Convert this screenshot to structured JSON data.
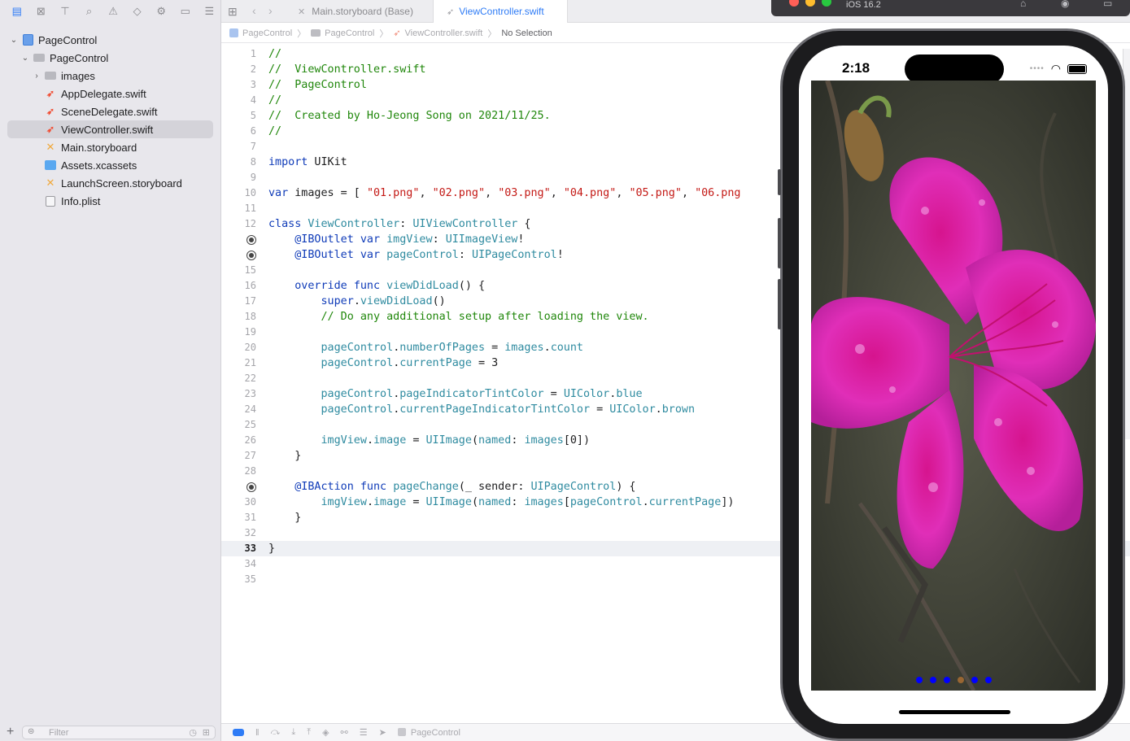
{
  "navigator": {
    "toolbar_icons": [
      "folder-icon",
      "source-control-icon",
      "symbol-icon",
      "find-icon",
      "issue-icon",
      "test-icon",
      "debug-icon",
      "breakpoint-icon",
      "report-icon"
    ],
    "tree": [
      {
        "label": "PageControl",
        "kind": "project",
        "level": 0,
        "expanded": true
      },
      {
        "label": "PageControl",
        "kind": "folder",
        "level": 1,
        "expanded": true
      },
      {
        "label": "images",
        "kind": "folder",
        "level": 2,
        "expanded": false
      },
      {
        "label": "AppDelegate.swift",
        "kind": "swift",
        "level": 2
      },
      {
        "label": "SceneDelegate.swift",
        "kind": "swift",
        "level": 2
      },
      {
        "label": "ViewController.swift",
        "kind": "swift",
        "level": 2,
        "selected": true
      },
      {
        "label": "Main.storyboard",
        "kind": "storyboard",
        "level": 2
      },
      {
        "label": "Assets.xcassets",
        "kind": "assets",
        "level": 2
      },
      {
        "label": "LaunchScreen.storyboard",
        "kind": "storyboard",
        "level": 2
      },
      {
        "label": "Info.plist",
        "kind": "plist",
        "level": 2
      }
    ],
    "filter_placeholder": "Filter"
  },
  "editor": {
    "tabs": [
      {
        "label": "Main.storyboard (Base)",
        "active": false
      },
      {
        "label": "ViewController.swift",
        "active": true
      }
    ],
    "jumpbar": [
      "PageControl",
      "PageControl",
      "ViewController.swift",
      "No Selection"
    ],
    "current_line": 33,
    "lines": [
      {
        "n": "1",
        "tokens": [
          [
            "cm",
            "//"
          ]
        ]
      },
      {
        "n": "2",
        "tokens": [
          [
            "cm",
            "//  ViewController.swift"
          ]
        ]
      },
      {
        "n": "3",
        "tokens": [
          [
            "cm",
            "//  PageControl"
          ]
        ]
      },
      {
        "n": "4",
        "tokens": [
          [
            "cm",
            "//"
          ]
        ]
      },
      {
        "n": "5",
        "tokens": [
          [
            "cm",
            "//  Created by Ho-Jeong Song on 2021/11/25."
          ]
        ]
      },
      {
        "n": "6",
        "tokens": [
          [
            "cm",
            "//"
          ]
        ]
      },
      {
        "n": "7",
        "tokens": []
      },
      {
        "n": "8",
        "tokens": [
          [
            "kw",
            "import"
          ],
          [
            "",
            " UIKit"
          ]
        ]
      },
      {
        "n": "9",
        "tokens": []
      },
      {
        "n": "10",
        "tokens": [
          [
            "kw",
            "var"
          ],
          [
            "",
            " images = [ "
          ],
          [
            "st",
            "\"01.png\""
          ],
          [
            "",
            ", "
          ],
          [
            "st",
            "\"02.png\""
          ],
          [
            "",
            ", "
          ],
          [
            "st",
            "\"03.png\""
          ],
          [
            "",
            ", "
          ],
          [
            "st",
            "\"04.png\""
          ],
          [
            "",
            ", "
          ],
          [
            "st",
            "\"05.png\""
          ],
          [
            "",
            ", "
          ],
          [
            "st",
            "\"06.png"
          ]
        ]
      },
      {
        "n": "11",
        "tokens": []
      },
      {
        "n": "12",
        "tokens": [
          [
            "kw",
            "class"
          ],
          [
            "",
            " "
          ],
          [
            "ty",
            "ViewController"
          ],
          [
            "",
            ": "
          ],
          [
            "ty",
            "UIViewController"
          ],
          [
            "",
            " {"
          ]
        ]
      },
      {
        "n": "",
        "outlet": true,
        "tokens": [
          [
            "",
            "    "
          ],
          [
            "kw",
            "@IBOutlet"
          ],
          [
            "",
            " "
          ],
          [
            "kw",
            "var"
          ],
          [
            "",
            " "
          ],
          [
            "ty",
            "imgView"
          ],
          [
            "",
            ": "
          ],
          [
            "ty",
            "UIImageView"
          ],
          [
            "",
            "!"
          ]
        ]
      },
      {
        "n": "",
        "outlet": true,
        "tokens": [
          [
            "",
            "    "
          ],
          [
            "kw",
            "@IBOutlet"
          ],
          [
            "",
            " "
          ],
          [
            "kw",
            "var"
          ],
          [
            "",
            " "
          ],
          [
            "ty",
            "pageControl"
          ],
          [
            "",
            ": "
          ],
          [
            "ty",
            "UIPageControl"
          ],
          [
            "",
            "!"
          ]
        ]
      },
      {
        "n": "15",
        "tokens": []
      },
      {
        "n": "16",
        "tokens": [
          [
            "",
            "    "
          ],
          [
            "kw",
            "override"
          ],
          [
            "",
            " "
          ],
          [
            "kw",
            "func"
          ],
          [
            "",
            " "
          ],
          [
            "ty",
            "viewDidLoad"
          ],
          [
            "",
            "() {"
          ]
        ]
      },
      {
        "n": "17",
        "tokens": [
          [
            "",
            "        "
          ],
          [
            "kw",
            "super"
          ],
          [
            "",
            "."
          ],
          [
            "pm",
            "viewDidLoad"
          ],
          [
            "",
            "()"
          ]
        ]
      },
      {
        "n": "18",
        "tokens": [
          [
            "",
            "        "
          ],
          [
            "cm",
            "// Do any additional setup after loading the view."
          ]
        ]
      },
      {
        "n": "19",
        "tokens": []
      },
      {
        "n": "20",
        "tokens": [
          [
            "",
            "        "
          ],
          [
            "pm",
            "pageControl"
          ],
          [
            "",
            "."
          ],
          [
            "pm",
            "numberOfPages"
          ],
          [
            "",
            " = "
          ],
          [
            "pm",
            "images"
          ],
          [
            "",
            "."
          ],
          [
            "pm",
            "count"
          ]
        ]
      },
      {
        "n": "21",
        "tokens": [
          [
            "",
            "        "
          ],
          [
            "pm",
            "pageControl"
          ],
          [
            "",
            "."
          ],
          [
            "pm",
            "currentPage"
          ],
          [
            "",
            " = 3"
          ]
        ]
      },
      {
        "n": "22",
        "tokens": []
      },
      {
        "n": "23",
        "tokens": [
          [
            "",
            "        "
          ],
          [
            "pm",
            "pageControl"
          ],
          [
            "",
            "."
          ],
          [
            "pm",
            "pageIndicatorTintColor"
          ],
          [
            "",
            " = "
          ],
          [
            "ty",
            "UIColor"
          ],
          [
            "",
            "."
          ],
          [
            "pm",
            "blue"
          ]
        ]
      },
      {
        "n": "24",
        "tokens": [
          [
            "",
            "        "
          ],
          [
            "pm",
            "pageControl"
          ],
          [
            "",
            "."
          ],
          [
            "pm",
            "currentPageIndicatorTintColor"
          ],
          [
            "",
            " = "
          ],
          [
            "ty",
            "UIColor"
          ],
          [
            "",
            "."
          ],
          [
            "pm",
            "brown"
          ]
        ]
      },
      {
        "n": "25",
        "tokens": []
      },
      {
        "n": "26",
        "tokens": [
          [
            "",
            "        "
          ],
          [
            "pm",
            "imgView"
          ],
          [
            "",
            "."
          ],
          [
            "pm",
            "image"
          ],
          [
            "",
            " = "
          ],
          [
            "ty",
            "UIImage"
          ],
          [
            "",
            "("
          ],
          [
            "pm",
            "named"
          ],
          [
            "",
            ": "
          ],
          [
            "pm",
            "images"
          ],
          [
            "",
            "[0])"
          ]
        ]
      },
      {
        "n": "27",
        "tokens": [
          [
            "",
            "    }"
          ]
        ]
      },
      {
        "n": "28",
        "tokens": []
      },
      {
        "n": "",
        "outlet": true,
        "tokens": [
          [
            "",
            "    "
          ],
          [
            "kw",
            "@IBAction"
          ],
          [
            "",
            " "
          ],
          [
            "kw",
            "func"
          ],
          [
            "",
            " "
          ],
          [
            "ty",
            "pageChange"
          ],
          [
            "",
            "(_ sender: "
          ],
          [
            "ty",
            "UIPageControl"
          ],
          [
            "",
            ") {"
          ]
        ]
      },
      {
        "n": "30",
        "tokens": [
          [
            "",
            "        "
          ],
          [
            "pm",
            "imgView"
          ],
          [
            "",
            "."
          ],
          [
            "pm",
            "image"
          ],
          [
            "",
            " = "
          ],
          [
            "ty",
            "UIImage"
          ],
          [
            "",
            "("
          ],
          [
            "pm",
            "named"
          ],
          [
            "",
            ": "
          ],
          [
            "pm",
            "images"
          ],
          [
            "",
            "["
          ],
          [
            "pm",
            "pageControl"
          ],
          [
            "",
            "."
          ],
          [
            "pm",
            "currentPage"
          ],
          [
            "",
            "])"
          ]
        ]
      },
      {
        "n": "31",
        "tokens": [
          [
            "",
            "    }"
          ]
        ]
      },
      {
        "n": "32",
        "tokens": []
      },
      {
        "n": "33",
        "tokens": [
          [
            "",
            "}"
          ]
        ]
      },
      {
        "n": "34",
        "tokens": []
      },
      {
        "n": "35",
        "tokens": []
      }
    ],
    "debug_target": "PageControl"
  },
  "simulator": {
    "os_label": "iOS 16.2",
    "time": "2:18",
    "page_count": 6,
    "current_page": 3,
    "indicator_color": "#0000ff",
    "current_indicator_color": "#996633"
  }
}
